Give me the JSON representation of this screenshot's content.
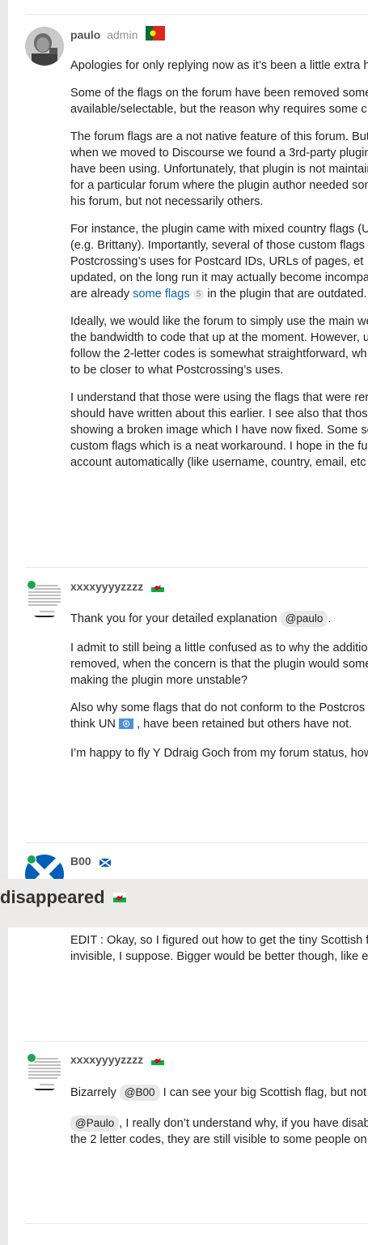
{
  "topic": {
    "title_fragment": "disappeared"
  },
  "posts": [
    {
      "username": "paulo",
      "user_title": "admin",
      "flag": "portugal-flag",
      "paragraphs": [
        [
          "Apologies for only replying now as it’s been a little extra he"
        ],
        [
          "Some of the flags on the forum have been removed some",
          "available/selectable, but the reason why requires some c"
        ],
        [
          "The forum flags are a not native feature of this forum. But",
          "when we moved to Discourse we found a 3rd-party plugin",
          "have been using. Unfortunately, that plugin is not maintain",
          "for a particular forum where the plugin author needed som",
          "his forum, but not necessarily others."
        ],
        [
          "For instance, the plugin came with mixed country flags (U",
          "(e.g. Brittany). Importantly, several of those custom flags",
          "Postcrossing’s uses for Postcard IDs, URLs of pages, et",
          "updated, on the long run it may actually become incompa"
        ],
        [
          "Ideally, we would like the forum to simply use the main we",
          "the bandwidth to code that up at the moment. However, u",
          "follow the 2-letter codes is somewhat straightforward, wh",
          "to be closer to what Postcrossing’s uses."
        ],
        [
          "I understand that those were using the flags that were rer",
          "should have written about this earlier. I see also that those",
          "showing a broken image which I have now fixed. Some se",
          "custom flags which is a neat workaround. I hope in the fu",
          "account automatically (like username, country, email, etc"
        ]
      ],
      "line_with_link": {
        "before": "are already ",
        "link": "some flags",
        "badge": "5",
        "after": " in the plugin that are outdated."
      }
    },
    {
      "username": "xxxxyyyyzzzz",
      "flag": "wales-flag",
      "thank_you": {
        "before": "Thank you for your detailed explanation ",
        "mention": "@paulo",
        "after": "."
      },
      "paragraphs": [
        [
          "I admit to still being a little confused as to why the additior",
          "removed, when the concern is that the plugin would some",
          "making the plugin more unstable?"
        ]
      ],
      "un_line": {
        "line1": "Also why some flags that do not conform to the Postcros",
        "before": "think UN ",
        "after": " , have been retained but others have not."
      },
      "last": "I’m happy to fly Y Ddraig Goch from my forum status, how"
    },
    {
      "username": "B00",
      "flag": "scotland-flag",
      "paragraphs": [
        [
          "EDIT : Okay, so I figured out how to get the tiny Scottish f",
          "invisible, I suppose. Bigger would be better though, like ev"
        ]
      ]
    },
    {
      "username": "xxxxyyyyzzzz",
      "flag": "wales-flag",
      "line1": {
        "before": "Bizarrely ",
        "mention": "@B00",
        "after": " I can see your big Scottish flag, but not"
      },
      "line2": {
        "mention": "@Paulo",
        "after": ", I really don’t understand why, if you have disab"
      },
      "line3": "the 2 letter codes, they are still visible to some people on"
    }
  ]
}
